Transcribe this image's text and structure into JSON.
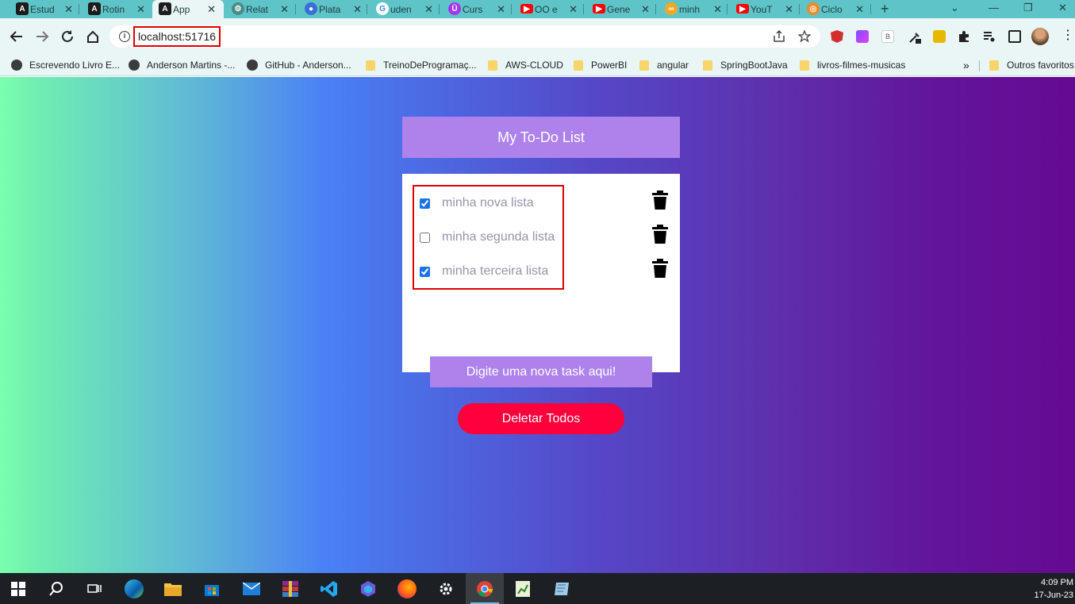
{
  "browser": {
    "tabs": [
      {
        "label": "Estud",
        "favicon": "angular-icon",
        "color": "#c3002f"
      },
      {
        "label": "Rotin",
        "favicon": "angular-icon",
        "color": "#c3002f"
      },
      {
        "label": "App",
        "favicon": "angular-icon",
        "color": "#c3002f",
        "active": true
      },
      {
        "label": "Relat",
        "favicon": "chatgpt-icon",
        "color": "#4a8c84"
      },
      {
        "label": "Plata",
        "favicon": "globe-icon",
        "color": "#3a6ed8"
      },
      {
        "label": "uden",
        "favicon": "google-icon",
        "color": "#ffffff"
      },
      {
        "label": "Curs",
        "favicon": "udemy-icon",
        "color": "#a435f0"
      },
      {
        "label": "OO e",
        "favicon": "youtube-icon",
        "color": "#ff0000"
      },
      {
        "label": "Gene",
        "favicon": "youtube-icon",
        "color": "#ff0000"
      },
      {
        "label": "minh",
        "favicon": "blogger-icon",
        "color": "#f5a623"
      },
      {
        "label": "YouT",
        "favicon": "youtube-icon",
        "color": "#ff0000"
      },
      {
        "label": "Ciclo",
        "favicon": "ciclo-icon",
        "color": "#f08a24"
      }
    ],
    "url": "localhost:51716",
    "bookmarks": [
      {
        "label": "Escrevendo Livro E...",
        "type": "globe"
      },
      {
        "label": "Anderson Martins -...",
        "type": "globe"
      },
      {
        "label": "GitHub - Anderson...",
        "type": "globe"
      },
      {
        "label": "TreinoDeProgramaç...",
        "type": "folder"
      },
      {
        "label": "AWS-CLOUD",
        "type": "folder"
      },
      {
        "label": "PowerBI",
        "type": "folder"
      },
      {
        "label": "angular",
        "type": "folder"
      },
      {
        "label": "SpringBootJava",
        "type": "folder"
      },
      {
        "label": "livros-filmes-musicas",
        "type": "folder"
      }
    ],
    "bookmarks_more": "»",
    "other_bookmarks": "Outros favoritos"
  },
  "app": {
    "title": "My To-Do List",
    "tasks": [
      {
        "label": "minha nova lista",
        "checked": true
      },
      {
        "label": "minha segunda lista",
        "checked": false
      },
      {
        "label": "minha terceira lista",
        "checked": true
      }
    ],
    "new_task_label": "Digite uma nova task aqui!",
    "delete_all_label": "Deletar Todos",
    "colors": {
      "header": "#ad82eb",
      "delete": "#ff003a",
      "highlight": "#e00000"
    }
  },
  "taskbar": {
    "time": "4:09 PM",
    "date": "17-Jun-23"
  }
}
